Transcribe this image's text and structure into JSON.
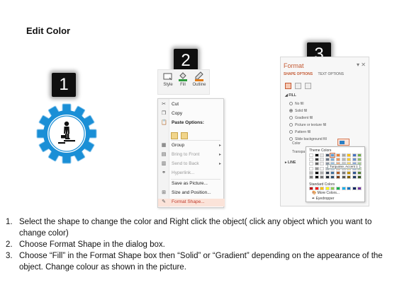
{
  "title": "Edit Color",
  "badges": [
    "1",
    "2",
    "3"
  ],
  "ribbon": {
    "style": "Style",
    "fill": "Fill",
    "outline": "Outline"
  },
  "context_menu": [
    {
      "label": "Cut",
      "icon": "scissors-icon",
      "disabled": false
    },
    {
      "label": "Copy",
      "icon": "copy-icon",
      "disabled": false
    },
    {
      "label": "Paste Options:",
      "icon": "paste-icon",
      "bold": true
    },
    {
      "label": "Group",
      "icon": "group-icon",
      "disabled": false,
      "submenu": true
    },
    {
      "label": "Bring to Front",
      "icon": "bring-front-icon",
      "disabled": true,
      "submenu": true
    },
    {
      "label": "Send to Back",
      "icon": "send-back-icon",
      "disabled": true,
      "submenu": true
    },
    {
      "label": "Hyperlink...",
      "icon": "link-icon",
      "disabled": true
    },
    {
      "label": "Save as Picture...",
      "icon": "",
      "disabled": false
    },
    {
      "label": "Size and Position...",
      "icon": "size-icon",
      "disabled": false
    },
    {
      "label": "Format Shape...",
      "icon": "format-shape-icon",
      "highlighted": true
    }
  ],
  "format_panel": {
    "title": "Format",
    "tabs": [
      "SHAPE OPTIONS",
      "TEXT OPTIONS"
    ],
    "fill_section": "FILL",
    "fill_options": [
      {
        "label": "No fill",
        "selected": false
      },
      {
        "label": "Solid fill",
        "selected": true
      },
      {
        "label": "Gradient fill",
        "selected": false
      },
      {
        "label": "Picture or texture fill",
        "selected": false
      },
      {
        "label": "Pattern fill",
        "selected": false
      },
      {
        "label": "Slide background fill",
        "selected": false
      }
    ],
    "color_label": "Color",
    "transparency_label": "Transpa",
    "line_section": "LINE",
    "accent": "#c45a34"
  },
  "dropdown": {
    "theme_header": "Theme Colors",
    "tooltip": "Turquoise, Accent 1",
    "standard_header": "Standard Colors",
    "more_colors": "More Colors...",
    "eyedropper": "Eyedropper",
    "theme_top": [
      "#ffffff",
      "#000000",
      "#e7e6e6",
      "#44546a",
      "#5b9bd5",
      "#ed7d31",
      "#a5a5a5",
      "#ffc000",
      "#4472c4",
      "#70ad47"
    ],
    "standard": [
      "#c00000",
      "#ff0000",
      "#ffc000",
      "#ffff00",
      "#92d050",
      "#00b050",
      "#00b0f0",
      "#0070c0",
      "#002060",
      "#7030a0"
    ]
  },
  "gear_color": "#1a8fd6",
  "steps": [
    {
      "num": "1.",
      "text": "Select the shape to change the color and Right click the object( click any object which you want to change color)"
    },
    {
      "num": "2.",
      "text": "Choose Format Shape in the dialog box."
    },
    {
      "num": "3.",
      "text": "Choose “Fill” in the Format Shape box then “Solid” or “Gradient” depending on the appearance of the object. Change colour as shown in the picture."
    }
  ]
}
